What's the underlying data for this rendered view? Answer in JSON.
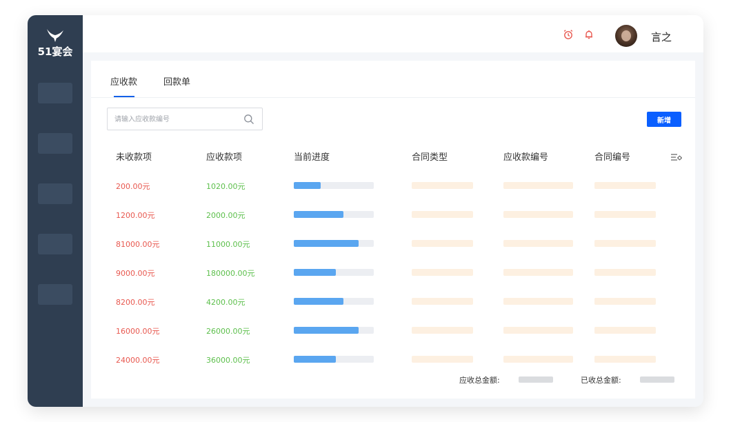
{
  "brand": {
    "logo_text": "51宴会"
  },
  "header": {
    "username": "言之",
    "icons": [
      "alarm-clock-icon",
      "bell-icon"
    ],
    "accent_color": "#e8584f"
  },
  "tabs": [
    {
      "label": "应收款",
      "active": true
    },
    {
      "label": "回款单",
      "active": false
    }
  ],
  "search": {
    "placeholder": "请输入应收款编号",
    "value": ""
  },
  "toolbar": {
    "add_label": "新增",
    "add_color": "#0a5fff"
  },
  "table": {
    "columns": [
      "未收款项",
      "应收款项",
      "当前进度",
      "合同类型",
      "应收款编号",
      "合同编号"
    ],
    "rows": [
      {
        "unpaid": "200.00元",
        "receivable": "1020.00元",
        "progress": 0.34
      },
      {
        "unpaid": "1200.00元",
        "receivable": "2000.00元",
        "progress": 0.62
      },
      {
        "unpaid": "81000.00元",
        "receivable": "11000.00元",
        "progress": 0.81
      },
      {
        "unpaid": "9000.00元",
        "receivable": "180000.00元",
        "progress": 0.53
      },
      {
        "unpaid": "8200.00元",
        "receivable": "4200.00元",
        "progress": 0.62
      },
      {
        "unpaid": "16000.00元",
        "receivable": "26000.00元",
        "progress": 0.81
      },
      {
        "unpaid": "24000.00元",
        "receivable": "36000.00元",
        "progress": 0.53
      }
    ]
  },
  "summary": {
    "receivable_total_label": "应收总金额:",
    "received_total_label": "已收总金额:"
  }
}
